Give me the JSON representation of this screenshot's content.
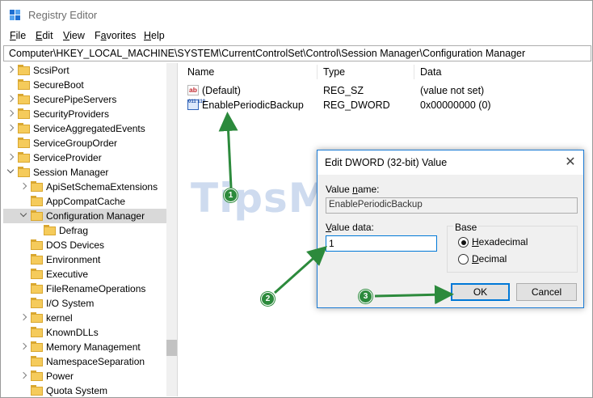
{
  "window": {
    "title": "Registry Editor"
  },
  "menu": [
    {
      "mnemonic": "F",
      "rest": "ile"
    },
    {
      "mnemonic": "E",
      "rest": "dit"
    },
    {
      "mnemonic": "V",
      "rest": "iew"
    },
    {
      "mnemonic": "",
      "pre": "F",
      "ul": "a",
      "post": "vorites"
    },
    {
      "mnemonic": "H",
      "rest": "elp"
    }
  ],
  "menu_labels": {
    "file_m": "F",
    "file_r": "ile",
    "edit_m": "E",
    "edit_r": "dit",
    "view_m": "V",
    "view_r": "iew",
    "fav_p": "F",
    "fav_m": "a",
    "fav_r": "vorites",
    "help_m": "H",
    "help_r": "elp"
  },
  "address": "Computer\\HKEY_LOCAL_MACHINE\\SYSTEM\\CurrentControlSet\\Control\\Session Manager\\Configuration Manager",
  "tree": {
    "items": [
      {
        "label": "ScsiPort",
        "level": 0,
        "expander": "collapsed"
      },
      {
        "label": "SecureBoot",
        "level": 0,
        "expander": "none"
      },
      {
        "label": "SecurePipeServers",
        "level": 0,
        "expander": "collapsed"
      },
      {
        "label": "SecurityProviders",
        "level": 0,
        "expander": "collapsed"
      },
      {
        "label": "ServiceAggregatedEvents",
        "level": 0,
        "expander": "collapsed"
      },
      {
        "label": "ServiceGroupOrder",
        "level": 0,
        "expander": "none"
      },
      {
        "label": "ServiceProvider",
        "level": 0,
        "expander": "collapsed"
      },
      {
        "label": "Session Manager",
        "level": 0,
        "expander": "expanded"
      },
      {
        "label": "ApiSetSchemaExtensions",
        "level": 1,
        "expander": "collapsed"
      },
      {
        "label": "AppCompatCache",
        "level": 1,
        "expander": "none"
      },
      {
        "label": "Configuration Manager",
        "level": 1,
        "expander": "expanded",
        "selected": true
      },
      {
        "label": "Defrag",
        "level": 2,
        "expander": "none"
      },
      {
        "label": "DOS Devices",
        "level": 1,
        "expander": "none"
      },
      {
        "label": "Environment",
        "level": 1,
        "expander": "none"
      },
      {
        "label": "Executive",
        "level": 1,
        "expander": "none"
      },
      {
        "label": "FileRenameOperations",
        "level": 1,
        "expander": "none"
      },
      {
        "label": "I/O System",
        "level": 1,
        "expander": "none"
      },
      {
        "label": "kernel",
        "level": 1,
        "expander": "collapsed"
      },
      {
        "label": "KnownDLLs",
        "level": 1,
        "expander": "none"
      },
      {
        "label": "Memory Management",
        "level": 1,
        "expander": "collapsed"
      },
      {
        "label": "NamespaceSeparation",
        "level": 1,
        "expander": "none"
      },
      {
        "label": "Power",
        "level": 1,
        "expander": "collapsed"
      },
      {
        "label": "Quota System",
        "level": 1,
        "expander": "none"
      }
    ]
  },
  "list": {
    "columns": [
      "Name",
      "Type",
      "Data"
    ],
    "rows": [
      {
        "icon": "string-value-icon",
        "icon_text": "ab",
        "name": "(Default)",
        "type": "REG_SZ",
        "data": "(value not set)"
      },
      {
        "icon": "binary-value-icon",
        "icon_text": "011 110",
        "name": "EnablePeriodicBackup",
        "type": "REG_DWORD",
        "data": "0x00000000 (0)"
      }
    ]
  },
  "watermark": "TipsMake",
  "dialog": {
    "title": "Edit DWORD (32-bit) Value",
    "close_glyph": "✕",
    "value_name_label_m": "",
    "value_name_label_pre": "Value ",
    "value_name_label_ul": "n",
    "value_name_label_post": "ame:",
    "value_name": "EnablePeriodicBackup",
    "value_data_label_ul": "V",
    "value_data_label_post": "alue data:",
    "value_data": "1",
    "base_label": "Base",
    "radio_hex_ul": "H",
    "radio_hex_rest": "exadecimal",
    "radio_dec_ul": "D",
    "radio_dec_rest": "ecimal",
    "base_selected": "hexadecimal",
    "ok_label": "OK",
    "cancel_label": "Cancel"
  },
  "steps": [
    "1",
    "2",
    "3"
  ],
  "colors": {
    "accent": "#0078d7",
    "annotation": "#2c8a3c",
    "folder": "#f5cb5b"
  }
}
